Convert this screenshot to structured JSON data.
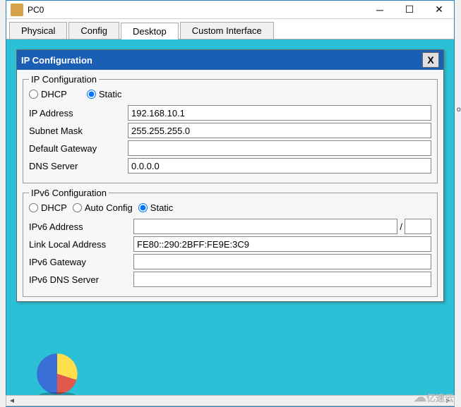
{
  "window": {
    "title": "PC0",
    "tabs": [
      "Physical",
      "Config",
      "Desktop",
      "Custom Interface"
    ],
    "active_tab": "Desktop"
  },
  "dialog": {
    "title": "IP Configuration",
    "close_label": "X"
  },
  "ipv4": {
    "legend": "IP Configuration",
    "radio_dhcp": "DHCP",
    "radio_static": "Static",
    "mode": "static",
    "fields": {
      "ip_label": "IP Address",
      "ip_value": "192.168.10.1",
      "subnet_label": "Subnet Mask",
      "subnet_value": "255.255.255.0",
      "gateway_label": "Default Gateway",
      "gateway_value": "",
      "dns_label": "DNS Server",
      "dns_value": "0.0.0.0"
    }
  },
  "ipv6": {
    "legend": "IPv6 Configuration",
    "radio_dhcp": "DHCP",
    "radio_auto": "Auto Config",
    "radio_static": "Static",
    "mode": "static",
    "fields": {
      "addr_label": "IPv6 Address",
      "addr_value": "",
      "prefix_value": "",
      "link_label": "Link Local Address",
      "link_value": "FE80::290:2BFF:FE9E:3C9",
      "gw_label": "IPv6 Gateway",
      "gw_value": "",
      "dns_label": "IPv6 DNS Server",
      "dns_value": ""
    }
  },
  "watermark": "亿速云",
  "partial": "or"
}
